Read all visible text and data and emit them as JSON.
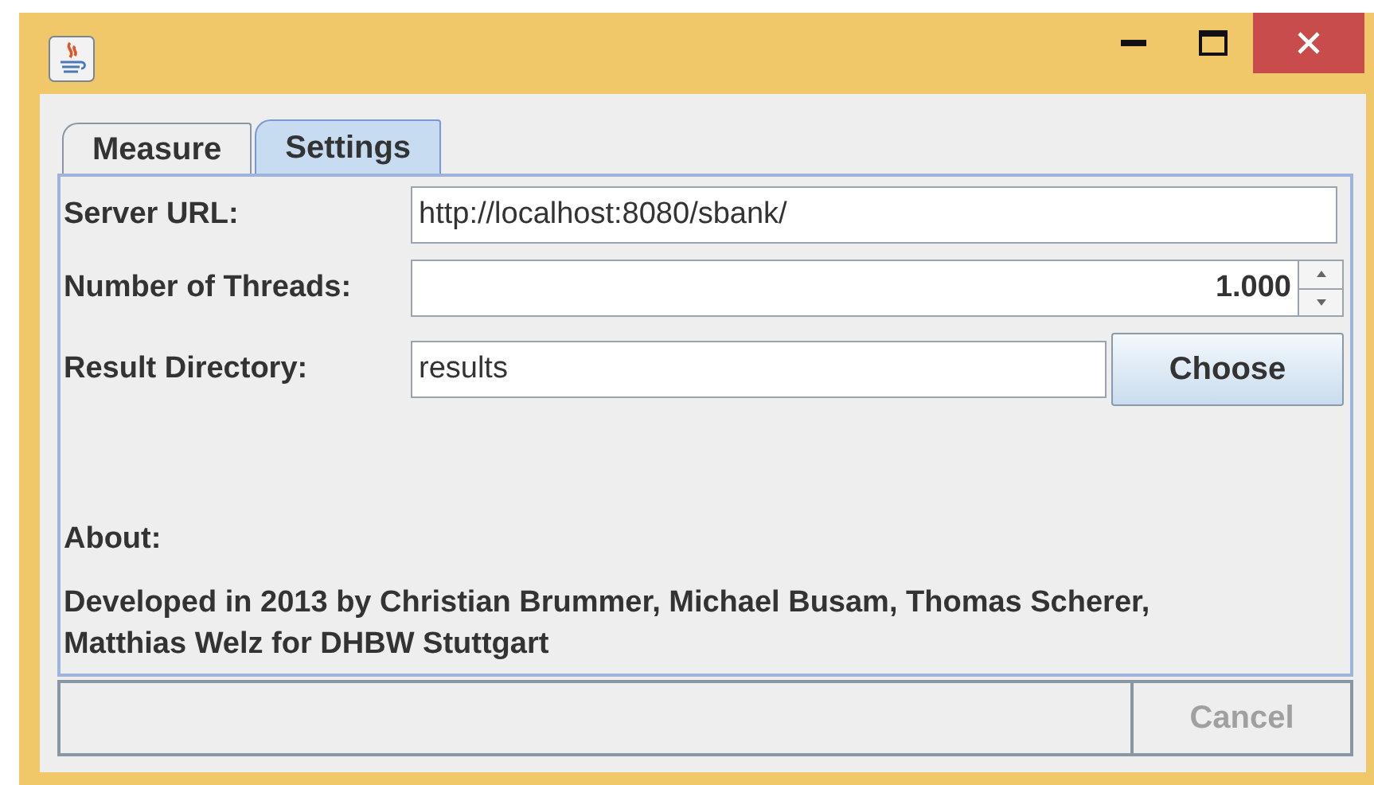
{
  "tabs": [
    {
      "label": "Measure",
      "selected": false
    },
    {
      "label": "Settings",
      "selected": true
    }
  ],
  "fields": [
    {
      "kind": "text",
      "label": "Server URL:",
      "value": "http://localhost:8080/sbank/"
    },
    {
      "kind": "spinner",
      "label": "Number of Threads:",
      "value": "1.000"
    },
    {
      "kind": "text_button",
      "label": "Result Directory:",
      "value": "results",
      "button": "Choose"
    }
  ],
  "about": {
    "heading": "About:",
    "text": "Developed in 2013 by Christian Brummer, Michael Busam, Thomas Scherer, Matthias Welz for DHBW Stuttgart"
  },
  "footer": {
    "cancel": {
      "label": "Cancel",
      "disabled": true
    }
  }
}
